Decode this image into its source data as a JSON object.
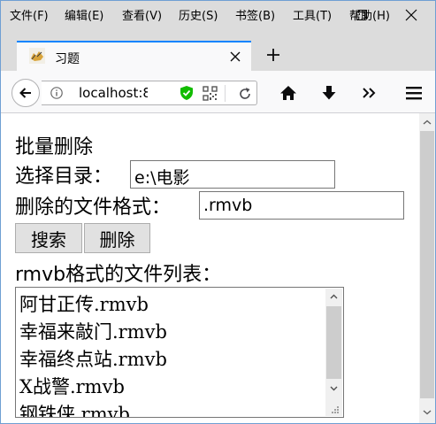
{
  "menu": {
    "items": [
      "文件(F)",
      "编辑(E)",
      "查看(V)",
      "历史(S)",
      "书签(B)",
      "工具(T)",
      "帮助(H)"
    ]
  },
  "tab": {
    "title": "习题"
  },
  "urlbar": {
    "url": "localhost:8"
  },
  "page": {
    "heading": "批量删除",
    "dir_label": "选择目录：",
    "dir_value": "e:\\电影",
    "format_label": "删除的文件格式：",
    "format_value": ".rmvb",
    "search_button": "搜索",
    "delete_button": "删除",
    "list_title": "rmvb格式的文件列表：",
    "files": [
      "阿甘正传.rmvb",
      "幸福来敲门.rmvb",
      "幸福终点站.rmvb",
      "X战警.rmvb",
      "钢铁侠.rmvb"
    ]
  },
  "colors": {
    "accent": "#0a84ff",
    "shield": "#12bc00"
  }
}
